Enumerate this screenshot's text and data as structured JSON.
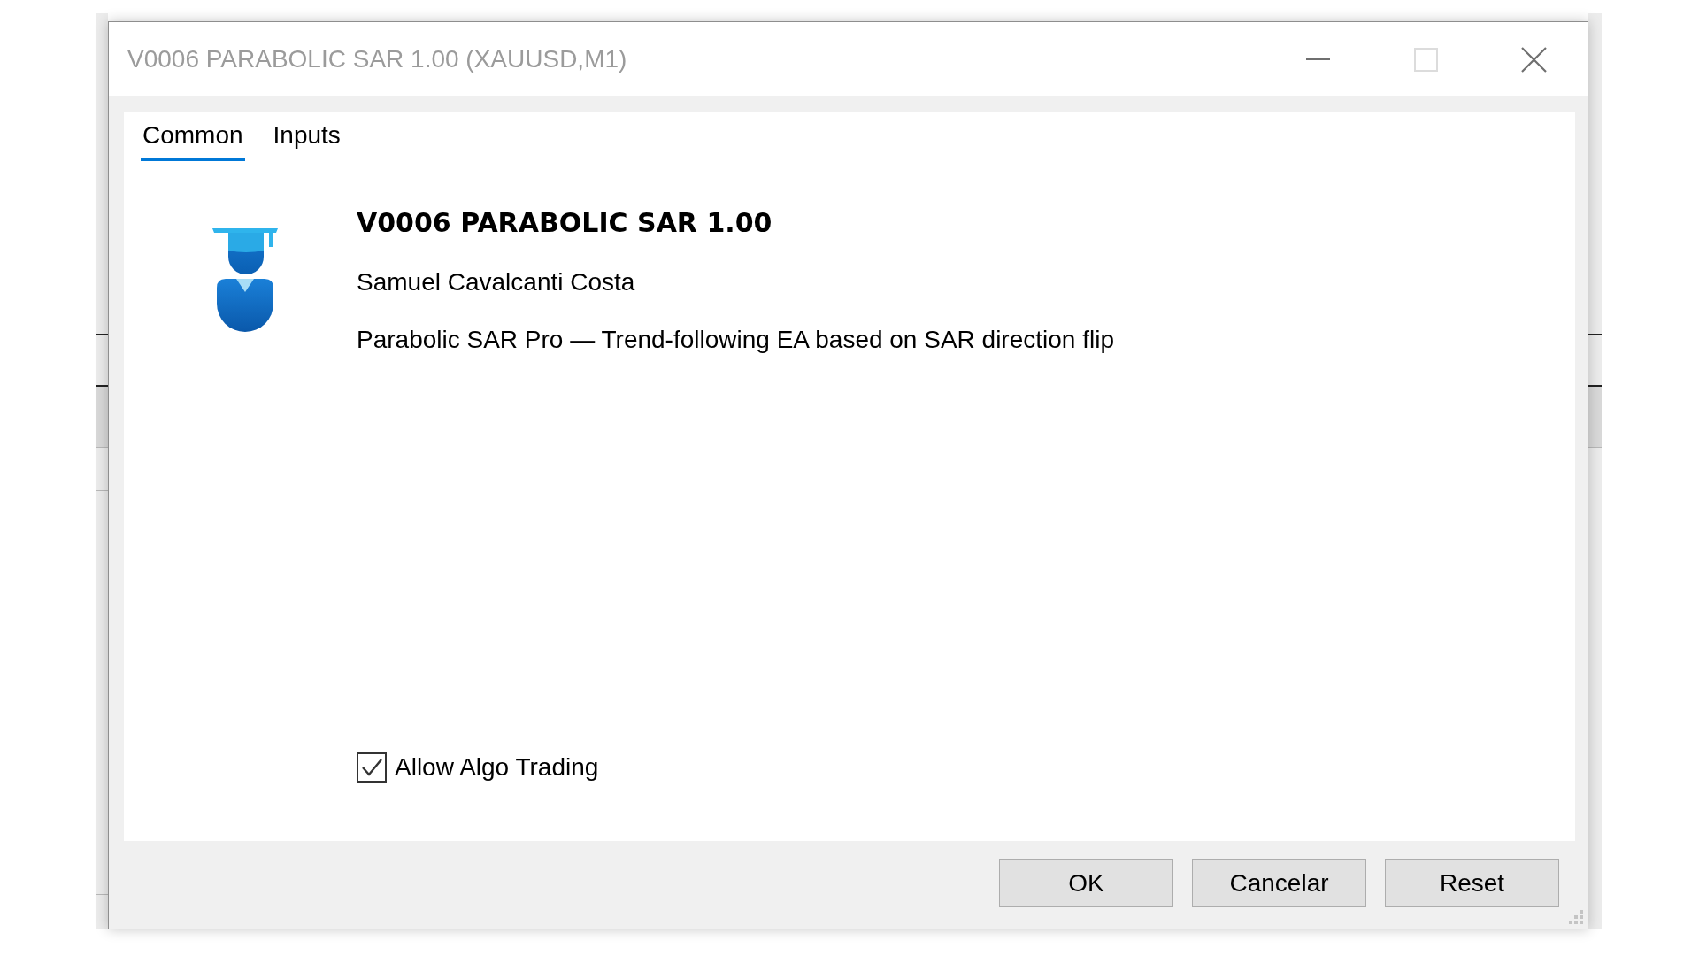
{
  "window": {
    "title": "V0006 PARABOLIC SAR 1.00 (XAUUSD,M1)",
    "controls": [
      {
        "kind": "minimize",
        "disabled": false
      },
      {
        "kind": "maximize",
        "disabled": true
      },
      {
        "kind": "close",
        "disabled": false
      }
    ]
  },
  "tabs": [
    {
      "label": "Common",
      "selected": true
    },
    {
      "label": "Inputs",
      "selected": false
    }
  ],
  "program": {
    "name": "V0006 PARABOLIC SAR 1.00",
    "author": "Samuel Cavalcanti Costa",
    "description": "Parabolic SAR Pro — Trend-following EA based on SAR direction flip"
  },
  "options": [
    {
      "label": "Allow Algo Trading",
      "checked": true
    }
  ],
  "buttons": [
    {
      "label": "OK"
    },
    {
      "label": "Cancelar"
    },
    {
      "label": "Reset"
    }
  ]
}
